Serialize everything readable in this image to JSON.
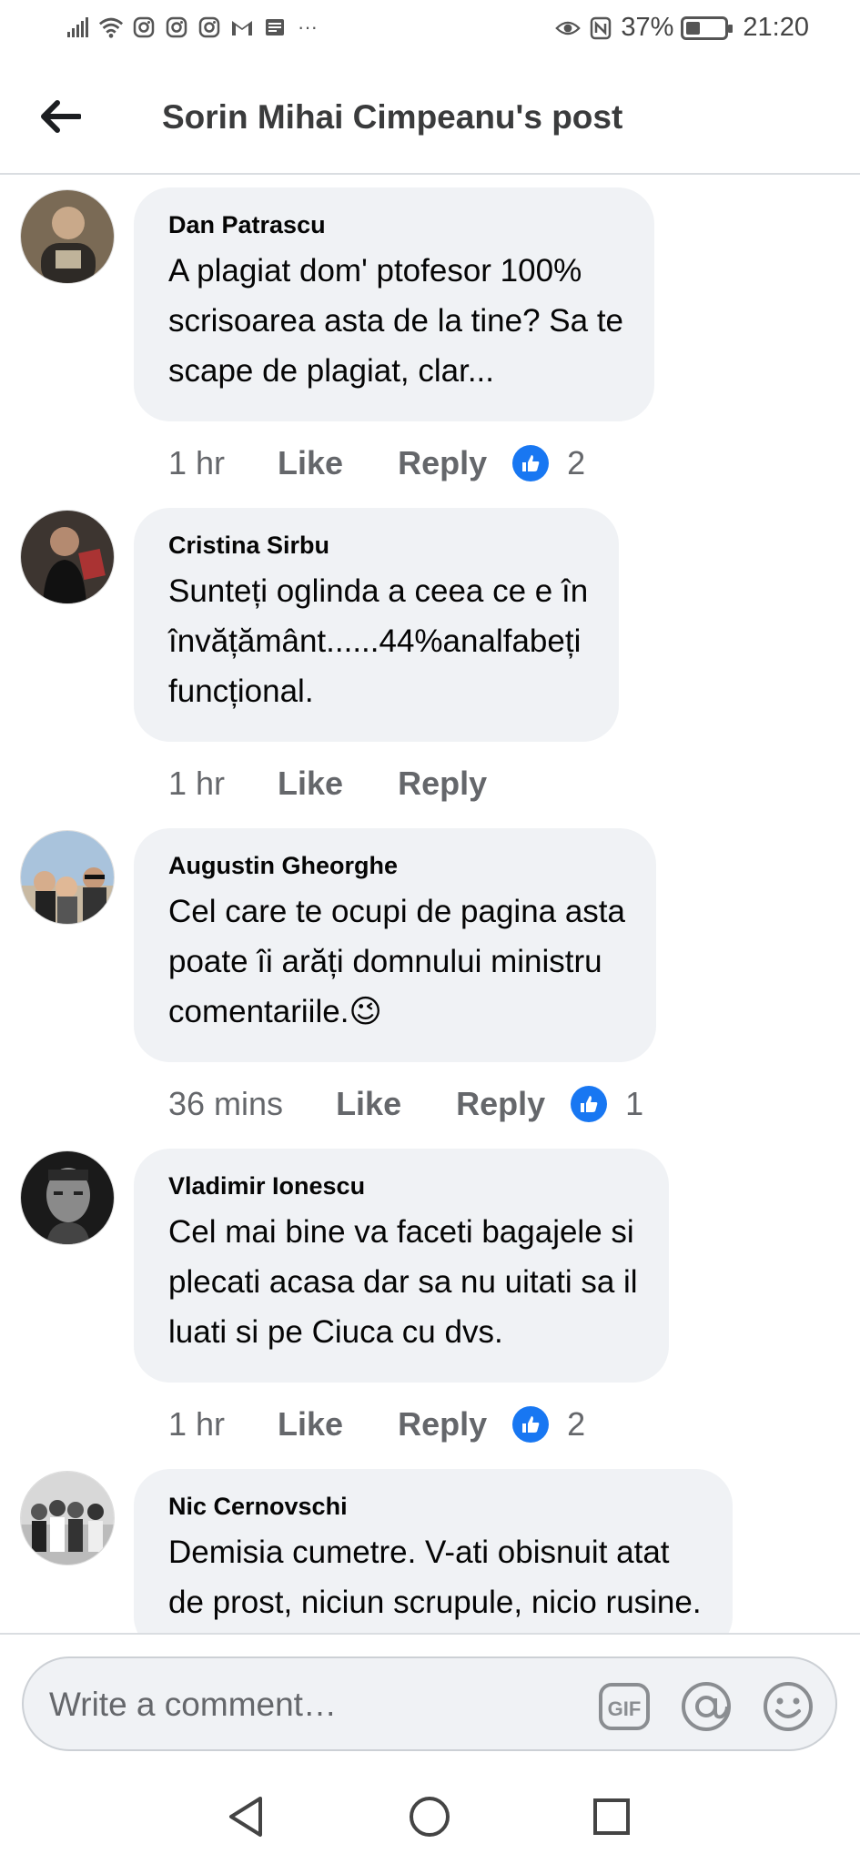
{
  "status_bar": {
    "battery_percent": "37%",
    "battery_level": 0.37,
    "time": "21:20",
    "left_icons": [
      "signal-icon",
      "wifi-icon",
      "instagram-icon",
      "instagram-icon",
      "instagram-icon",
      "gmail-icon",
      "news-icon",
      "more-dots-icon"
    ],
    "more": "···"
  },
  "header": {
    "title": "Sorin Mihai Cimpeanu's post"
  },
  "comments": [
    {
      "author": "Dan Patrascu",
      "text": "A plagiat dom' ptofesor 100%\nscrisoarea asta de la tine? Sa te\nscape de plagiat, clar...",
      "time": "1 hr",
      "like_label": "Like",
      "reply_label": "Reply",
      "reactions": "2",
      "avatar_color": "#5a4a3a"
    },
    {
      "author": "Cristina Sirbu",
      "text": "Sunteți oglinda a ceea ce e în\nînvățământ......44%analfabeți\nfuncțional.",
      "time": "1 hr",
      "like_label": "Like",
      "reply_label": "Reply",
      "reactions": "",
      "avatar_color": "#2a2420"
    },
    {
      "author": "Augustin Gheorghe",
      "text": "Cel care te ocupi de pagina asta\npoate îi arăți domnului ministru\ncomentariile.😉",
      "time": "36 mins",
      "like_label": "Like",
      "reply_label": "Reply",
      "reactions": "1",
      "avatar_color": "#8fa8c0"
    },
    {
      "author": "Vladimir Ionescu",
      "text": "Cel mai bine va faceti bagajele si\nplecati acasa dar sa nu uitati sa il\nluati si pe Ciuca cu dvs.",
      "time": "1 hr",
      "like_label": "Like",
      "reply_label": "Reply",
      "reactions": "2",
      "avatar_color": "#3a3a3a"
    },
    {
      "author": "Nic Cernovschi",
      "text": "Demisia cumetre. V-ati obisnuit atat\nde prost, niciun scrupule, nicio rusine.",
      "time": "",
      "like_label": "",
      "reply_label": "",
      "reactions": "",
      "avatar_color": "#6b6b6b"
    }
  ],
  "composer": {
    "placeholder": "Write a comment…",
    "gif_label": "GIF"
  },
  "colors": {
    "facebook_blue": "#1877f2",
    "bubble_bg": "#f0f2f5",
    "secondary_text": "#65676b"
  }
}
